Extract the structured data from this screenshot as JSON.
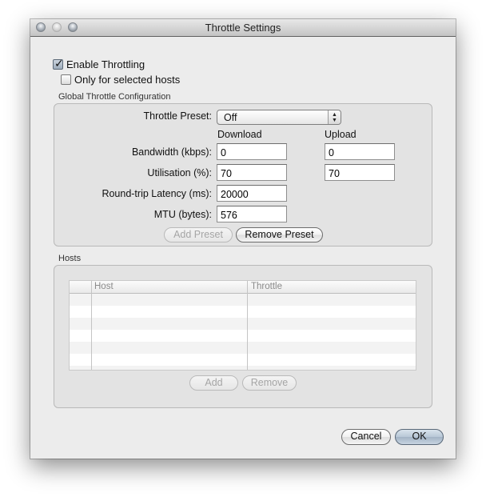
{
  "window": {
    "title": "Throttle Settings",
    "controls": [
      "close-button",
      "minimize-button",
      "zoom-button"
    ]
  },
  "options": {
    "enable_throttling": {
      "label": "Enable Throttling",
      "checked": true
    },
    "only_selected_hosts": {
      "label": "Only for selected hosts",
      "checked": false
    }
  },
  "global_config": {
    "group_label": "Global Throttle Configuration",
    "preset_label": "Throttle Preset:",
    "preset_value": "Off",
    "download_header": "Download",
    "upload_header": "Upload",
    "bandwidth_label": "Bandwidth (kbps):",
    "bandwidth_download": "0",
    "bandwidth_upload": "0",
    "utilisation_label": "Utilisation (%):",
    "utilisation_download": "70",
    "utilisation_upload": "70",
    "latency_label": "Round-trip Latency (ms):",
    "latency_value": "20000",
    "mtu_label": "MTU (bytes):",
    "mtu_value": "576",
    "add_preset_label": "Add Preset",
    "add_preset_enabled": false,
    "remove_preset_label": "Remove Preset"
  },
  "hosts": {
    "group_label": "Hosts",
    "columns": [
      "",
      "Host",
      "Throttle"
    ],
    "rows": [],
    "add_label": "Add",
    "remove_label": "Remove"
  },
  "footer": {
    "cancel_label": "Cancel",
    "ok_label": "OK"
  }
}
